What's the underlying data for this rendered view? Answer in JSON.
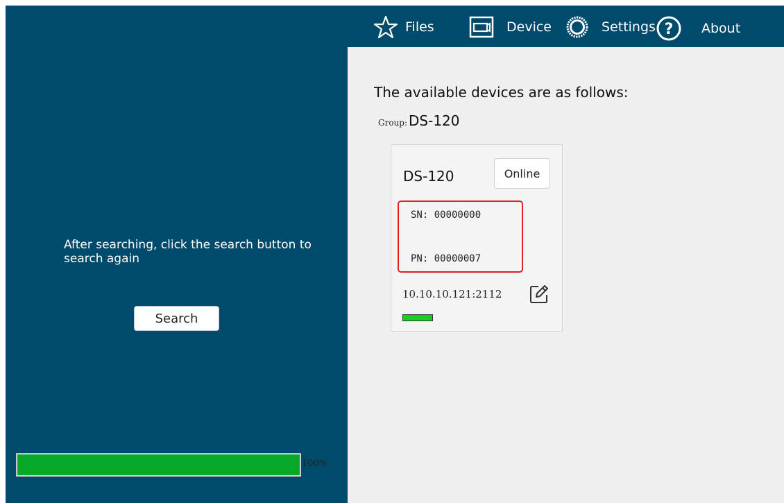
{
  "nav": {
    "files_label": "Files",
    "device_label": "Device",
    "settings_label": "Settings",
    "about_label": "About"
  },
  "left": {
    "message": "After searching, click the search button to search again",
    "search_button": "Search",
    "progress_value": 1.0,
    "progress_text": "100%"
  },
  "main": {
    "heading": "The available devices are as follows:",
    "group_label": "Group:",
    "group_name": "DS-120",
    "devices": [
      {
        "name": "DS-120",
        "status": "Online",
        "sn_text": "SN: 00000000",
        "pn_text": "PN: 00000007",
        "address": "10.10.10.121:2112"
      }
    ]
  },
  "colors": {
    "panel": "#004a6b",
    "content_bg": "#f0f0f0",
    "progress_green": "#06a82a",
    "connection_green": "#16d11b",
    "highlight_red": "#e0201f"
  },
  "icons": [
    "star-icon",
    "device-icon",
    "gear-icon",
    "help-icon",
    "edit-icon"
  ]
}
